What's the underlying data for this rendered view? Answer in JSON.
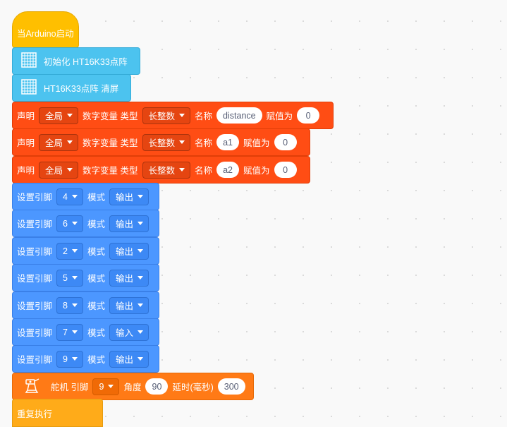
{
  "hat": {
    "label": "当Arduino启动"
  },
  "matrix_blocks": [
    {
      "label": "初始化 HT16K33点阵"
    },
    {
      "label": "HT16K33点阵 清屏"
    }
  ],
  "declare_blocks": [
    {
      "prefix": "声明",
      "scope": "全局",
      "type_label": "数字变量 类型",
      "dtype": "长整数",
      "name_label": "名称",
      "name": "distance",
      "assign_label": "赋值为",
      "value": "0"
    },
    {
      "prefix": "声明",
      "scope": "全局",
      "type_label": "数字变量 类型",
      "dtype": "长整数",
      "name_label": "名称",
      "name": "a1",
      "assign_label": "赋值为",
      "value": "0"
    },
    {
      "prefix": "声明",
      "scope": "全局",
      "type_label": "数字变量 类型",
      "dtype": "长整数",
      "name_label": "名称",
      "name": "a2",
      "assign_label": "赋值为",
      "value": "0"
    }
  ],
  "pin_blocks": [
    {
      "label": "设置引脚",
      "pin": "4",
      "mode_label": "模式",
      "mode": "输出"
    },
    {
      "label": "设置引脚",
      "pin": "6",
      "mode_label": "模式",
      "mode": "输出"
    },
    {
      "label": "设置引脚",
      "pin": "2",
      "mode_label": "模式",
      "mode": "输出"
    },
    {
      "label": "设置引脚",
      "pin": "5",
      "mode_label": "模式",
      "mode": "输出"
    },
    {
      "label": "设置引脚",
      "pin": "8",
      "mode_label": "模式",
      "mode": "输出"
    },
    {
      "label": "设置引脚",
      "pin": "7",
      "mode_label": "模式",
      "mode": "输入"
    },
    {
      "label": "设置引脚",
      "pin": "9",
      "mode_label": "模式",
      "mode": "输出"
    }
  ],
  "servo_block": {
    "icon": "servo-icon",
    "label": "舵机 引脚",
    "pin": "9",
    "angle_label": "角度",
    "angle": "90",
    "delay_label": "延时(毫秒)",
    "delay": "300"
  },
  "loop_block": {
    "label": "重复执行"
  },
  "colors": {
    "canvas": "#f9f9f9",
    "event": "#ffbf00",
    "matrix": "#4cc3ef",
    "declare": "#ff4d14",
    "pin": "#4c97ff",
    "servo": "#ff7a16",
    "loop": "#ffab19"
  }
}
